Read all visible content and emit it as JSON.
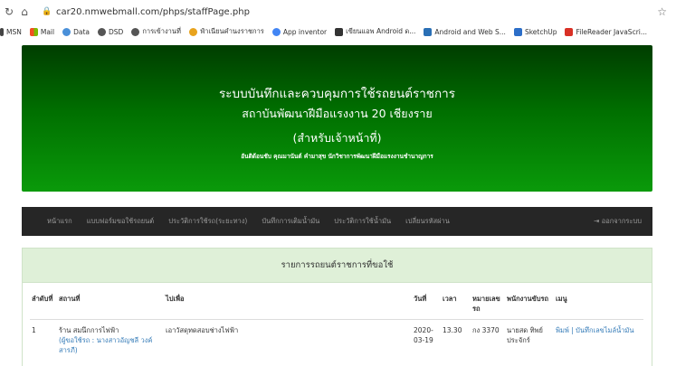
{
  "browser": {
    "url": "car20.nmwebmall.com/phps/staffPage.php",
    "bookmarks": [
      "MSN",
      "Mail",
      "Data",
      "DSD",
      "การเข้างานที่",
      "ฟำเนียนคำนงราชการ",
      "App inventor",
      "เขียนแอพ Android ด...",
      "Android and Web S...",
      "SketchUp",
      "FileReader JavaScri..."
    ]
  },
  "header": {
    "title": "ระบบบันทึกและควบคุมการใช้รถยนต์ราชการ",
    "subtitle": "สถาบันพัฒนาฝีมือแรงงาน 20 เชียงราย",
    "role": "(สำหรับเจ้าหน้าที่)",
    "developer": "อันติด้อนชับ คุณมานันต์ คำมาสุข นักวิชาการพัฒนาฝีมือแรงงานชำนาญการ"
  },
  "nav": {
    "items": [
      "หน้าแรก",
      "แบบฟอร์มขอใช้รถยนต์",
      "ประวัติการใช้รถ(ระยะทาง)",
      "บันทึกการเติมน้ำมัน",
      "ประวัติการใช้น้ำมัน",
      "เปลี่ยนรหัสผ่าน"
    ],
    "logout": "ออกจากระบบ"
  },
  "panel": {
    "title": "รายการรถยนต์ราชการที่ขอใช้"
  },
  "table": {
    "headers": [
      "ลำดับที่",
      "สถานที่",
      "ไปเพื่อ",
      "วันที่",
      "เวลา",
      "หมายเลขรถ",
      "พนักงานขับรถ",
      "เมนู"
    ],
    "rows": [
      {
        "no": "1",
        "place": "ร้าน สมนึกการไฟฟ้า",
        "requester": "(ผู้ขอใช้รถ : นางสาวอัญชลี วงค์สารภี)",
        "purpose": "เอาวัสดุทดสอบช่างไฟฟ้า",
        "date": "2020-03-19",
        "time": "13.30",
        "plate": "กง 3370",
        "driver": "นายสด ทิพย์ประจักร์",
        "menu": "พิมพ์ | บันทึกเลขไมล์น้ำมัน"
      }
    ]
  },
  "colors": {
    "banner_dark": "#003d00",
    "banner_light": "#0a9a0a",
    "nav_bg": "#262626",
    "panel_head_bg": "#dff0d8",
    "link": "#337ab7"
  }
}
